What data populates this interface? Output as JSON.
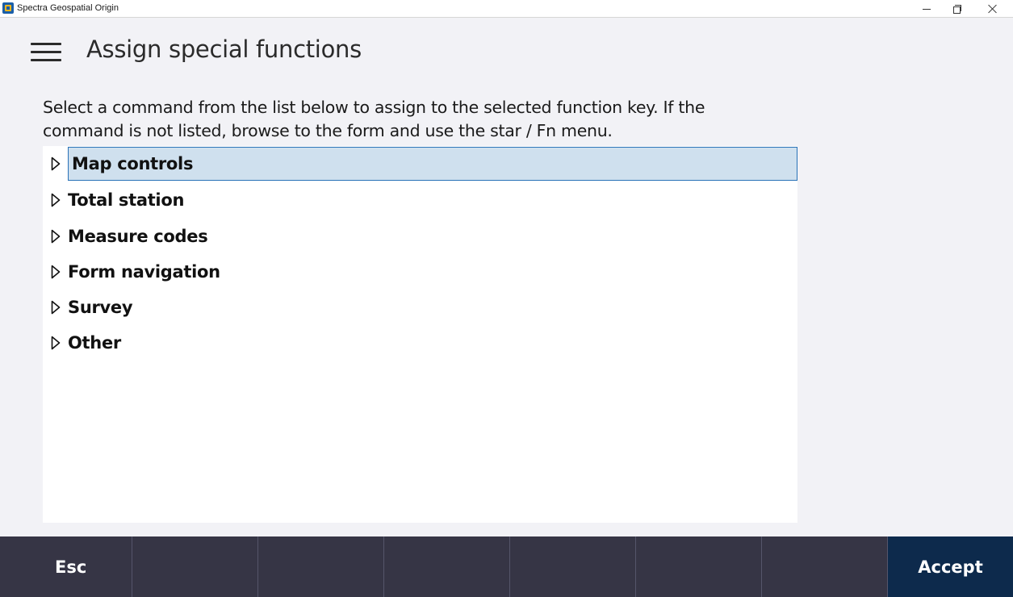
{
  "window": {
    "title": "Spectra Geospatial Origin"
  },
  "header": {
    "title": "Assign special functions"
  },
  "instructions": "Select a command from the list below to assign to the selected function key. If the command is not listed, browse to the form and use the star / Fn menu.",
  "tree": {
    "selected_index": 0,
    "items": [
      {
        "label": "Map controls"
      },
      {
        "label": "Total station"
      },
      {
        "label": "Measure codes"
      },
      {
        "label": "Form navigation"
      },
      {
        "label": "Survey"
      },
      {
        "label": "Other"
      }
    ]
  },
  "function_bar": {
    "esc_label": "Esc",
    "accept_label": "Accept"
  },
  "colors": {
    "selection_fill": "#cfe0ee",
    "selection_border": "#2a73b8",
    "function_bar": "#363545",
    "accept_button": "#0d2a4c"
  }
}
